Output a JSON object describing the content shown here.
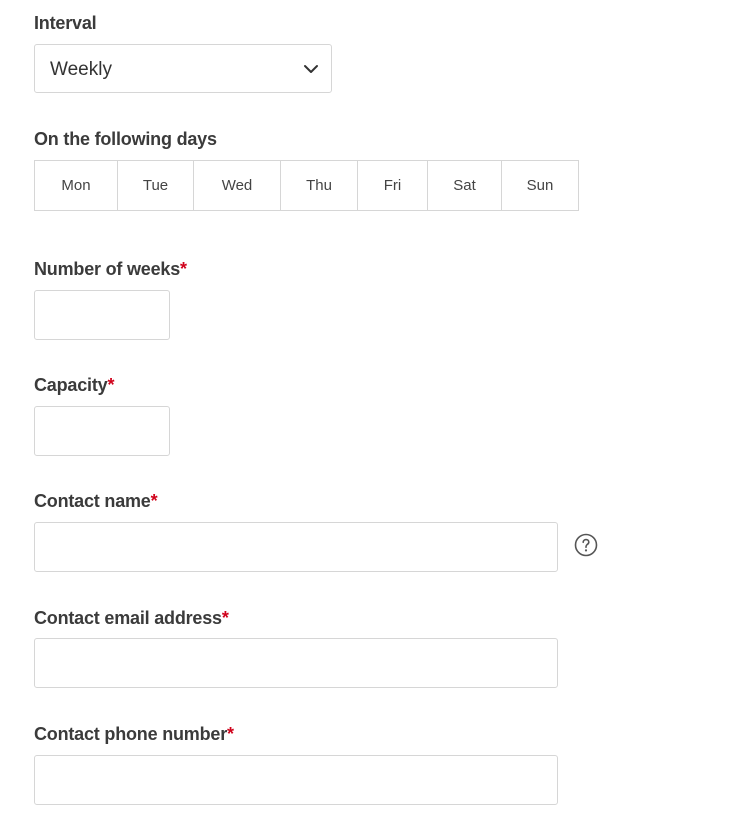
{
  "interval": {
    "label": "Interval",
    "selected": "Weekly"
  },
  "days": {
    "label": "On the following days",
    "items": [
      "Mon",
      "Tue",
      "Wed",
      "Thu",
      "Fri",
      "Sat",
      "Sun"
    ]
  },
  "weeks": {
    "label": "Number of weeks",
    "required_mark": "*",
    "value": ""
  },
  "capacity": {
    "label": "Capacity",
    "required_mark": "*",
    "value": ""
  },
  "contact_name": {
    "label": "Contact name",
    "required_mark": "*",
    "value": ""
  },
  "contact_email": {
    "label": "Contact email address",
    "required_mark": "*",
    "value": ""
  },
  "contact_phone": {
    "label": "Contact phone number",
    "required_mark": "*",
    "value": ""
  },
  "icons": {
    "select_chevron": "chevron-down-icon",
    "help": "help-circle-icon"
  },
  "colors": {
    "required": "#d0021b",
    "border": "#d6d6d6",
    "label": "#3b3b3b"
  }
}
